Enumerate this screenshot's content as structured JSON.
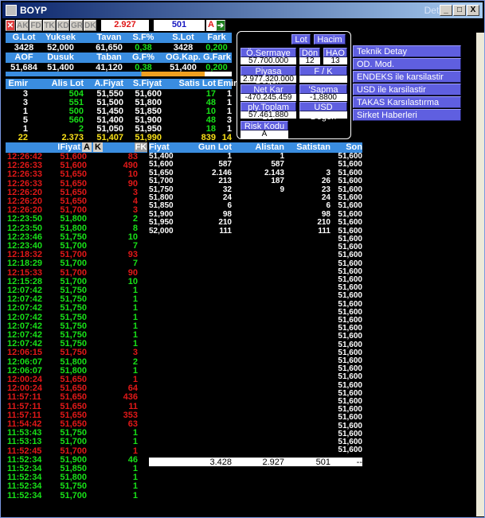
{
  "title": "BOYP",
  "title_right": "Detay",
  "window_buttons": [
    "_",
    "□",
    "X"
  ],
  "tabs": [
    "AK",
    "FD",
    "TK",
    "KD",
    "GR",
    "DK"
  ],
  "price_box": "2.927",
  "volume_box": "501",
  "alert_label": "A",
  "top_headers": [
    "G.Lot",
    "Yuksek",
    "Tavan",
    "S.F%",
    "S.Lot",
    "Fark"
  ],
  "top_values": [
    "3428",
    "52,000",
    "61,650",
    "0,38",
    "3428",
    "0,200"
  ],
  "mid_headers": [
    "AOF",
    "Dusuk",
    "Taban",
    "G.F%",
    "OG.Kap.",
    "G.Fark"
  ],
  "mid_values": [
    "51,684",
    "51,400",
    "41,120",
    "0,38",
    "51,400",
    "0,200"
  ],
  "depth_headers": [
    "Emir",
    "Alis Lot",
    "A.Fiyat",
    "S.Fiyat",
    "Satis Lot",
    "Emir"
  ],
  "depth_rows": [
    [
      "3",
      "504",
      "51,550",
      "51,600",
      "17",
      "1"
    ],
    [
      "3",
      "551",
      "51,500",
      "51,800",
      "48",
      "1"
    ],
    [
      "1",
      "500",
      "51,450",
      "51,850",
      "10",
      "1"
    ],
    [
      "5",
      "560",
      "51,400",
      "51,900",
      "48",
      "3"
    ],
    [
      "1",
      "2",
      "51,050",
      "51,950",
      "18",
      "1"
    ]
  ],
  "depth_total": [
    "22",
    "2.373",
    "51,407",
    "51,990",
    "839",
    "14"
  ],
  "panel": {
    "btn_lot": "Lot",
    "btn_hacim": "Hacim",
    "o_sermaye": "Ö.Sermaye",
    "o_sermaye_val": "57.700.000",
    "don": "Dön",
    "don_val": "12",
    "hao": "HAO",
    "hao_val": "13",
    "piyasa": "Piyasa Değeri",
    "piyasa_val": "2.977.320.000",
    "fk": "F / K",
    "fk_val": "",
    "netkar": "Net Kar",
    "netkar_val": "-470.245.459",
    "sapma": "'Sapma",
    "sapma_val": "-1,8800",
    "toplot": "ply.Toplam Lot",
    "toplot_val": "57.461.880",
    "usd": "USD Değeri",
    "usd_val": "",
    "risk": "Risk Kodu",
    "risk_val": "A"
  },
  "links": [
    "Teknik Detay",
    "OD. Mod.",
    "ENDEKS ile karsilastir",
    "USD ile karsilastir",
    "TAKAS Karsılastırma",
    "Sirket Haberleri"
  ],
  "trades_header": {
    "fiyat": "IFiyat",
    "b1": "A",
    "b2": "K",
    "fk": "FK"
  },
  "trades": [
    [
      "12:26:42",
      "51,600",
      "83",
      "r"
    ],
    [
      "12:26:33",
      "51,600",
      "490",
      "r"
    ],
    [
      "12:26:33",
      "51,650",
      "10",
      "r"
    ],
    [
      "12:26:33",
      "51,650",
      "90",
      "r"
    ],
    [
      "12:26:20",
      "51,650",
      "3",
      "r"
    ],
    [
      "12:26:20",
      "51,650",
      "4",
      "r"
    ],
    [
      "12:26:20",
      "51,700",
      "3",
      "r"
    ],
    [
      "12:23:50",
      "51,800",
      "2",
      "g"
    ],
    [
      "12:23:50",
      "51,800",
      "8",
      "g"
    ],
    [
      "12:23:46",
      "51,750",
      "10",
      "g"
    ],
    [
      "12:23:40",
      "51,700",
      "7",
      "g"
    ],
    [
      "12:18:32",
      "51,700",
      "93",
      "r"
    ],
    [
      "12:18:29",
      "51,700",
      "7",
      "g"
    ],
    [
      "12:15:33",
      "51,700",
      "90",
      "r"
    ],
    [
      "12:15:28",
      "51,700",
      "10",
      "g"
    ],
    [
      "12:07:42",
      "51,750",
      "1",
      "g"
    ],
    [
      "12:07:42",
      "51,750",
      "1",
      "g"
    ],
    [
      "12:07:42",
      "51,750",
      "1",
      "g"
    ],
    [
      "12:07:42",
      "51,750",
      "1",
      "g"
    ],
    [
      "12:07:42",
      "51,750",
      "1",
      "g"
    ],
    [
      "12:07:42",
      "51,750",
      "1",
      "g"
    ],
    [
      "12:07:42",
      "51,750",
      "1",
      "g"
    ],
    [
      "12:06:15",
      "51,750",
      "3",
      "r"
    ],
    [
      "12:06:07",
      "51,800",
      "2",
      "g"
    ],
    [
      "12:06:07",
      "51,800",
      "1",
      "g"
    ],
    [
      "12:00:24",
      "51,650",
      "1",
      "r"
    ],
    [
      "12:00:24",
      "51,650",
      "64",
      "r"
    ],
    [
      "11:57:11",
      "51,650",
      "436",
      "r"
    ],
    [
      "11:57:11",
      "51,650",
      "11",
      "r"
    ],
    [
      "11:57:11",
      "51,650",
      "353",
      "r"
    ],
    [
      "11:54:42",
      "51,650",
      "63",
      "r"
    ],
    [
      "11:53:43",
      "51,750",
      "1",
      "g"
    ],
    [
      "11:53:13",
      "51,700",
      "1",
      "g"
    ],
    [
      "11:52:45",
      "51,700",
      "1",
      "r"
    ],
    [
      "11:52:34",
      "51,900",
      "46",
      "g"
    ],
    [
      "11:52:34",
      "51,850",
      "1",
      "g"
    ],
    [
      "11:52:34",
      "51,800",
      "1",
      "g"
    ],
    [
      "11:52:34",
      "51,750",
      "1",
      "g"
    ],
    [
      "11:52:34",
      "51,700",
      "1",
      "g"
    ]
  ],
  "dist_headers": [
    "Fiyat",
    "Gun Lot",
    "Alistan",
    "Satistan",
    "Son"
  ],
  "dist_rows": [
    [
      "51,400",
      "1",
      "1",
      "",
      "51,600"
    ],
    [
      "51,600",
      "587",
      "587",
      "",
      "51,600"
    ],
    [
      "51,650",
      "2.146",
      "2.143",
      "3",
      "51,600"
    ],
    [
      "51,700",
      "213",
      "187",
      "26",
      "51,600"
    ],
    [
      "51,750",
      "32",
      "9",
      "23",
      "51,600"
    ],
    [
      "51,800",
      "24",
      "",
      "24",
      "51,600"
    ],
    [
      "51,850",
      "6",
      "",
      "6",
      "51,600"
    ],
    [
      "51,900",
      "98",
      "",
      "98",
      "51,600"
    ],
    [
      "51,950",
      "210",
      "",
      "210",
      "51,600"
    ],
    [
      "52,000",
      "111",
      "",
      "111",
      "51,600"
    ]
  ],
  "son_extra": [
    "51,600",
    "51,600",
    "51,600",
    "51,600",
    "51,600",
    "51,600",
    "51,600",
    "51,600",
    "51,600",
    "51,600",
    "51,600",
    "51,600",
    "51,600",
    "51,600",
    "51,600",
    "51,600",
    "51,600",
    "51,600",
    "51,600",
    "51,600",
    "51,600",
    "51,600",
    "51,600",
    "51,600",
    "51,600",
    "51,600",
    "51,600"
  ],
  "dist_total": [
    "3.428",
    "2.927",
    "501",
    "--"
  ]
}
